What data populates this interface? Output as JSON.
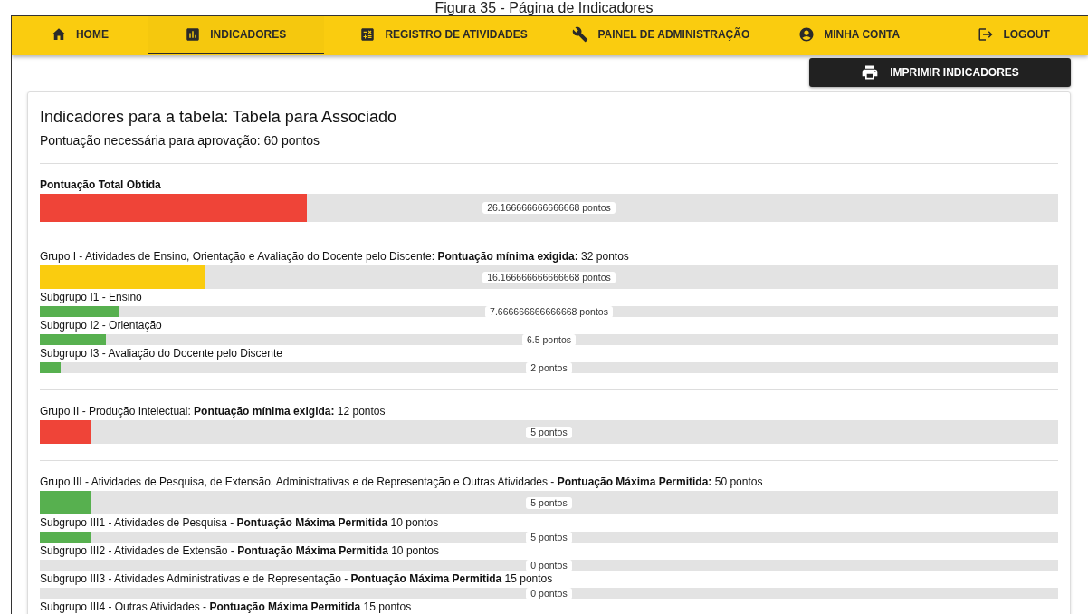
{
  "caption": "Figura 35 - Página de Indicadores",
  "nav": [
    {
      "label": "HOME",
      "selected": false
    },
    {
      "label": "INDICADORES",
      "selected": true
    },
    {
      "label": "REGISTRO DE ATIVIDADES",
      "selected": false
    },
    {
      "label": "PAINEL DE ADMINISTRAÇÃO",
      "selected": false
    },
    {
      "label": "MINHA CONTA",
      "selected": false
    },
    {
      "label": "LOGOUT",
      "selected": false
    }
  ],
  "print_button": "IMPRIMIR INDICADORES",
  "title": "Indicadores para a tabela: Tabela para Associado",
  "subtitle": "Pontuação necessária para aprovação: 60 pontos",
  "sections": [
    {
      "items": [
        {
          "kind": "total",
          "label": "Pontuação Total Obtida",
          "level": 0.262,
          "color": "#ef4438",
          "reading": "26.166666666666668 pontos"
        }
      ]
    },
    {
      "items": [
        {
          "kind": "group",
          "label": "Grupo I - Atividades de Ensino, Orientação e Avaliação do Docente pelo Discente: **Pontuação mínima exigida:** 32 pontos",
          "level": 0.162,
          "color": "#facc0f",
          "reading": "16.166666666666668 pontos"
        },
        {
          "kind": "subgroup",
          "label": "Subgrupo I1 - Ensino",
          "level": 0.077,
          "color": "#57b04f",
          "reading": "7.666666666666668 pontos"
        },
        {
          "kind": "subgroup",
          "label": "Subgrupo I2 - Orientação",
          "level": 0.065,
          "color": "#57b04f",
          "reading": "6.5 pontos"
        },
        {
          "kind": "subgroup",
          "label": "Subgrupo I3 - Avaliação do Docente pelo Discente",
          "level": 0.02,
          "color": "#57b04f",
          "reading": "2 pontos"
        }
      ]
    },
    {
      "items": [
        {
          "kind": "group",
          "label": "Grupo II - Produção Intelectual: **Pontuação mínima exigida:** 12 pontos",
          "level": 0.05,
          "color": "#ef4438",
          "reading": "5 pontos"
        }
      ]
    },
    {
      "items": [
        {
          "kind": "group",
          "label": "Grupo III - Atividades de Pesquisa, de Extensão, Administrativas e de Representação e Outras Atividades - **Pontuação Máxima Permitida:** 50 pontos",
          "level": 0.05,
          "color": "#57b04f",
          "reading": "5 pontos"
        },
        {
          "kind": "subgroup",
          "label": "Subgrupo III1 - Atividades de Pesquisa - **Pontuação Máxima Permitida** 10 pontos",
          "level": 0.05,
          "color": "#57b04f",
          "reading": "5 pontos"
        },
        {
          "kind": "subgroup",
          "label": "Subgrupo III2 - Atividades de Extensão - **Pontuação Máxima Permitida** 10 pontos",
          "reading": "0 pontos"
        },
        {
          "kind": "subgroup",
          "label": "Subgrupo III3 - Atividades Administrativas e de Representação - **Pontuação Máxima Permitida** 15 pontos",
          "reading": "0 pontos"
        },
        {
          "kind": "subgroup",
          "label": "Subgrupo III4 - Outras Atividades - **Pontuação Máxima Permitida** 15 pontos"
        }
      ]
    }
  ]
}
